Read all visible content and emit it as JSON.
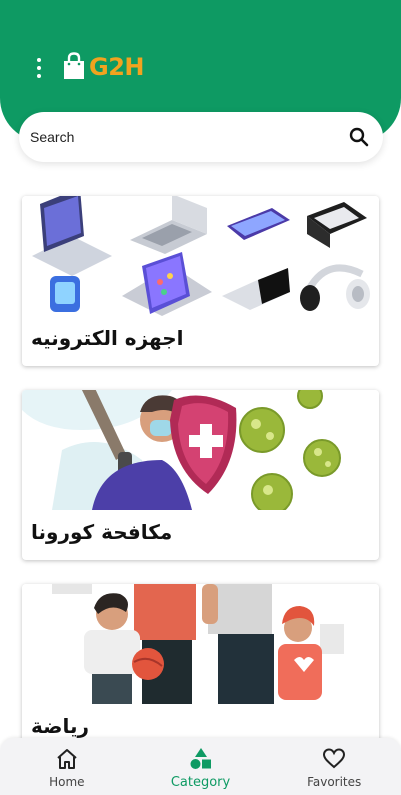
{
  "app": {
    "logo_text": "G2H",
    "brand_color": "#0e9a63",
    "accent_color": "#f1a31f"
  },
  "search": {
    "placeholder": "Search",
    "icon": "search-icon"
  },
  "categories": [
    {
      "title": "اجهزه الكترونيه",
      "image": "electronics-devices"
    },
    {
      "title": "مكافحة كورونا",
      "image": "corona-fight"
    },
    {
      "title": "رياضة",
      "image": "sports-family"
    }
  ],
  "bottom_nav": {
    "items": [
      {
        "label": "Home",
        "icon": "home-icon",
        "active": false
      },
      {
        "label": "Category",
        "icon": "category-icon",
        "active": true
      },
      {
        "label": "Favorites",
        "icon": "heart-icon",
        "active": false
      }
    ]
  }
}
